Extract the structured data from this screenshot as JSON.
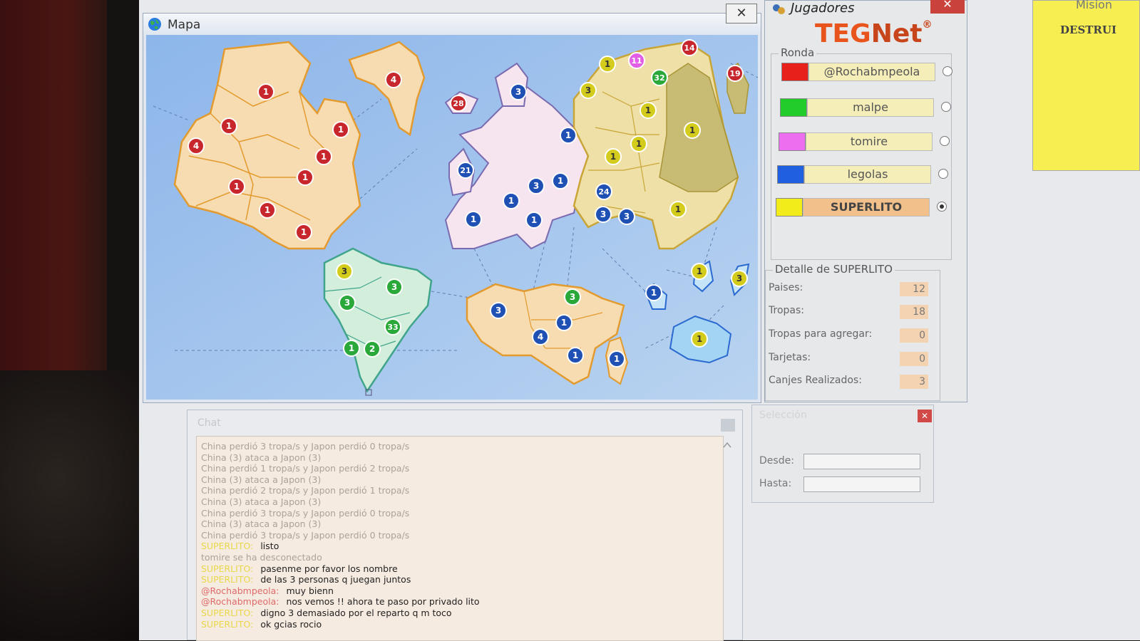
{
  "map_window": {
    "title": "Mapa",
    "close_glyph": "✕",
    "armies": [
      {
        "count": "1",
        "color": "#c7262c"
      },
      {
        "count": "4",
        "color": "#c7262c"
      },
      {
        "count": "1",
        "color": "#c7262c"
      },
      {
        "count": "1",
        "color": "#c7262c"
      },
      {
        "count": "4",
        "color": "#c7262c"
      },
      {
        "count": "1",
        "color": "#c7262c"
      },
      {
        "count": "1",
        "color": "#c7262c"
      },
      {
        "count": "1",
        "color": "#c7262c"
      },
      {
        "count": "1",
        "color": "#c7262c"
      },
      {
        "count": "1",
        "color": "#c7262c"
      },
      {
        "count": "28",
        "color": "#c7262c"
      },
      {
        "count": "3",
        "color": "#1f50b4"
      },
      {
        "count": "21",
        "color": "#1f50b4"
      },
      {
        "count": "1",
        "color": "#1f50b4"
      },
      {
        "count": "1",
        "color": "#1f50b4"
      },
      {
        "count": "3",
        "color": "#1f50b4"
      },
      {
        "count": "1",
        "color": "#1f50b4"
      },
      {
        "count": "1",
        "color": "#1f50b4"
      },
      {
        "count": "1",
        "color": "#1f50b4"
      },
      {
        "count": "24",
        "color": "#1f50b4"
      },
      {
        "count": "3",
        "color": "#1f50b4"
      },
      {
        "count": "3",
        "color": "#1f50b4"
      },
      {
        "count": "1",
        "color": "#d4cc1c"
      },
      {
        "count": "11",
        "color": "#e35ee6"
      },
      {
        "count": "14",
        "color": "#c7262c"
      },
      {
        "count": "19",
        "color": "#c7262c"
      },
      {
        "count": "3",
        "color": "#d4cc1c"
      },
      {
        "count": "32",
        "color": "#2aa83a"
      },
      {
        "count": "1",
        "color": "#d4cc1c"
      },
      {
        "count": "1",
        "color": "#d4cc1c"
      },
      {
        "count": "1",
        "color": "#d4cc1c"
      },
      {
        "count": "1",
        "color": "#d4cc1c"
      },
      {
        "count": "1",
        "color": "#d4cc1c"
      },
      {
        "count": "3",
        "color": "#d4cc1c"
      },
      {
        "count": "3",
        "color": "#2aa83a"
      },
      {
        "count": "3",
        "color": "#2aa83a"
      },
      {
        "count": "33",
        "color": "#2aa83a"
      },
      {
        "count": "1",
        "color": "#2aa83a"
      },
      {
        "count": "2",
        "color": "#2aa83a"
      },
      {
        "count": "3",
        "color": "#2aa83a"
      },
      {
        "count": "3",
        "color": "#1f50b4"
      },
      {
        "count": "4",
        "color": "#1f50b4"
      },
      {
        "count": "1",
        "color": "#1f50b4"
      },
      {
        "count": "1",
        "color": "#1f50b4"
      },
      {
        "count": "1",
        "color": "#1f50b4"
      },
      {
        "count": "1",
        "color": "#1f50b4"
      },
      {
        "count": "1",
        "color": "#d4cc1c"
      },
      {
        "count": "3",
        "color": "#d4cc1c"
      },
      {
        "count": "1",
        "color": "#d4cc1c"
      },
      {
        "count": "1",
        "color": "#d4cc1c"
      }
    ]
  },
  "players_window": {
    "title": "Jugadores",
    "logo_teg": "TEG",
    "logo_net": "Net",
    "logo_reg": "®",
    "round_label": "Ronda",
    "players": [
      {
        "name": "@Rochabmpeola",
        "color": "#e8201c",
        "active": false
      },
      {
        "name": "malpe",
        "color": "#22cc2a",
        "active": false
      },
      {
        "name": "tomire",
        "color": "#ee6ef0",
        "active": false
      },
      {
        "name": "legolas",
        "color": "#1f5fe0",
        "active": false
      },
      {
        "name": "SUPERLITO",
        "color": "#f2ec1a",
        "active": true
      }
    ],
    "detail_label": "Detalle de SUPERLITO",
    "details": [
      {
        "label": "Paises:",
        "value": "12"
      },
      {
        "label": "Tropas:",
        "value": "18"
      },
      {
        "label": "Tropas para agregar:",
        "value": "0"
      },
      {
        "label": "Tarjetas:",
        "value": "0"
      },
      {
        "label": "Canjes Realizados:",
        "value": "3"
      }
    ]
  },
  "mission_window": {
    "title": "Mision",
    "text": "DESTRUI"
  },
  "chat_window": {
    "title": "Chat",
    "lines": [
      {
        "who": "",
        "text": "China perdió 3 tropa/s y Japon perdió 0 tropa/s",
        "sys": true
      },
      {
        "who": "",
        "text": "China (3) ataca a Japon (3)",
        "sys": true
      },
      {
        "who": "",
        "text": "China perdió 1 tropa/s y Japon perdió 2 tropa/s",
        "sys": true
      },
      {
        "who": "",
        "text": "China (3) ataca a Japon (3)",
        "sys": true
      },
      {
        "who": "",
        "text": "China perdió 2 tropa/s y Japon perdió 1 tropa/s",
        "sys": true
      },
      {
        "who": "",
        "text": "China (3) ataca a Japon (3)",
        "sys": true
      },
      {
        "who": "",
        "text": "China perdió 3 tropa/s y Japon perdió 0 tropa/s",
        "sys": true
      },
      {
        "who": "",
        "text": "China (3) ataca a Japon (3)",
        "sys": true
      },
      {
        "who": "",
        "text": "China perdió 3 tropa/s y Japon perdió 0 tropa/s",
        "sys": true
      },
      {
        "who": "SUPERLITO:",
        "text": "listo",
        "sys": false,
        "color": "#e8d84a"
      },
      {
        "who": "",
        "text": "tomire se ha desconectado",
        "sys": true
      },
      {
        "who": "SUPERLITO:",
        "text": "pasenme por favor los nombre",
        "sys": false,
        "color": "#e8d84a"
      },
      {
        "who": "SUPERLITO:",
        "text": "de las 3 personas q juegan juntos",
        "sys": false,
        "color": "#e8d84a"
      },
      {
        "who": "@Rochabmpeola:",
        "text": "muy bienn",
        "sys": false,
        "color": "#e06a6a"
      },
      {
        "who": "@Rochabmpeola:",
        "text": "nos vemos !! ahora te paso por privado lito",
        "sys": false,
        "color": "#e06a6a"
      },
      {
        "who": "SUPERLITO:",
        "text": "digno 3 demasiado por el reparto q m toco",
        "sys": false,
        "color": "#e8d84a"
      },
      {
        "who": "SUPERLITO:",
        "text": "ok gcias rocio",
        "sys": false,
        "color": "#e8d84a"
      }
    ]
  },
  "selection_window": {
    "title": "Selección",
    "from_label": "Desde:",
    "to_label": "Hasta:",
    "from_value": "",
    "to_value": ""
  }
}
